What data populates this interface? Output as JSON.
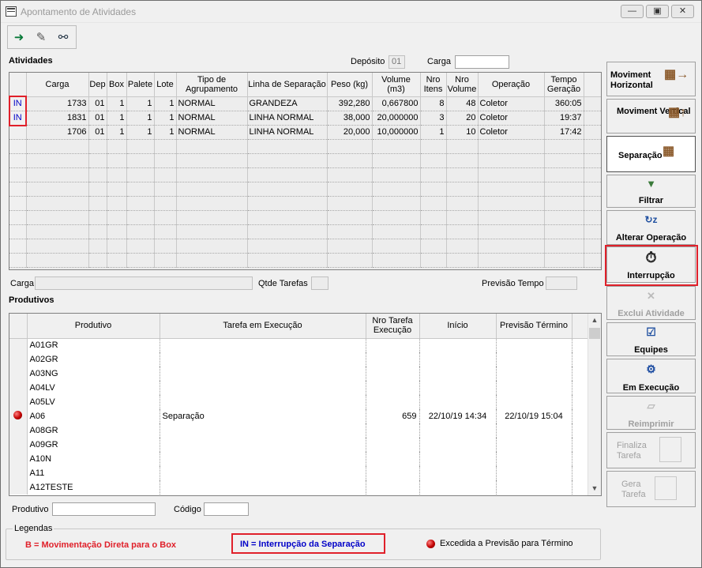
{
  "window": {
    "title": "Apontamento de Atividades"
  },
  "toolbar": {
    "buttons": [
      {
        "name": "exit-icon",
        "glyph": "⇥"
      },
      {
        "name": "eraser-icon",
        "glyph": "✎"
      },
      {
        "name": "binoculars-icon",
        "glyph": "⌕"
      }
    ]
  },
  "atividades": {
    "title": "Atividades",
    "deposito_label": "Depósito",
    "deposito_value": "01",
    "carga_label": "Carga",
    "carga_value": "",
    "columns": [
      "",
      "Carga",
      "Dep",
      "Box",
      "Palete",
      "Lote",
      "Tipo de Agrupamento",
      "Linha de Separação",
      "Peso (kg)",
      "Volume (m3)",
      "Nro Itens",
      "Nro Volume",
      "Operação",
      "Tempo Geração"
    ],
    "rows": [
      [
        "IN",
        "1733",
        "01",
        "1",
        "1",
        "1",
        "NORMAL",
        "GRANDEZA",
        "392,280",
        "0,667800",
        "8",
        "48",
        "Coletor",
        "360:05"
      ],
      [
        "IN",
        "1831",
        "01",
        "1",
        "1",
        "1",
        "NORMAL",
        "LINHA NORMAL",
        "38,000",
        "20,000000",
        "3",
        "20",
        "Coletor",
        "19:37"
      ],
      [
        "",
        "1706",
        "01",
        "1",
        "1",
        "1",
        "NORMAL",
        "LINHA NORMAL",
        "20,000",
        "10,000000",
        "1",
        "10",
        "Coletor",
        "17:42"
      ]
    ],
    "empty_rows": 9
  },
  "summary": {
    "carga_label": "Carga",
    "carga_value": "",
    "qtde_label": "Qtde Tarefas",
    "qtde_value": "",
    "previsao_label": "Previsão Tempo",
    "previsao_value": ""
  },
  "produtivos": {
    "title": "Produtivos",
    "columns": [
      "",
      "Produtivo",
      "Tarefa em Execução",
      "Nro Tarefa Execução",
      "Início",
      "Previsão Término"
    ],
    "rows": [
      [
        "",
        "A01GR",
        "",
        "",
        "",
        ""
      ],
      [
        "",
        "A02GR",
        "",
        "",
        "",
        ""
      ],
      [
        "",
        "A03NG",
        "",
        "",
        "",
        ""
      ],
      [
        "",
        "A04LV",
        "",
        "",
        "",
        ""
      ],
      [
        "",
        "A05LV",
        "",
        "",
        "",
        ""
      ],
      [
        "dot",
        "A06",
        "Separação",
        "659",
        "22/10/19 14:34",
        "22/10/19 15:04"
      ],
      [
        "",
        "A08GR",
        "",
        "",
        "",
        ""
      ],
      [
        "",
        "A09GR",
        "",
        "",
        "",
        ""
      ],
      [
        "",
        "A10N",
        "",
        "",
        "",
        ""
      ],
      [
        "",
        "A11",
        "",
        "",
        "",
        ""
      ],
      [
        "",
        "A12TESTE",
        "",
        "",
        "",
        ""
      ]
    ]
  },
  "filters": {
    "produtivo_label": "Produtivo",
    "produtivo_value": "",
    "codigo_label": "Código",
    "codigo_value": ""
  },
  "legend": {
    "title": "Legendas",
    "item1": "B = Movimentação Direta para o Box",
    "item2": "IN = Interrupção da Separação",
    "item3": "Excedida a Previsão para Término",
    "colors": {
      "red": "#e0202a",
      "blue": "#0000c8"
    }
  },
  "side_buttons": [
    {
      "name": "moviment-horizontal-button",
      "label": "Moviment Horizontal",
      "icon": "pallet-horizontal-icon",
      "enabled": true
    },
    {
      "name": "moviment-vertical-button",
      "label": "Moviment Vertical",
      "icon": "pallet-vertical-icon",
      "enabled": true
    },
    {
      "name": "separacao-button",
      "label": "Separação",
      "icon": "pallet-separation-icon",
      "enabled": true
    },
    {
      "name": "filtrar-button",
      "label": "Filtrar",
      "icon": "filter-icon",
      "enabled": true
    },
    {
      "name": "alterar-operacao-button",
      "label": "Alterar Operação",
      "icon": "sort-az-icon",
      "enabled": true
    },
    {
      "name": "interrupcao-button",
      "label": "Interrupção",
      "icon": "stopwatch-icon",
      "enabled": true
    },
    {
      "name": "exclui-atividade-button",
      "label": "Exclui Atividade",
      "icon": "delete-icon",
      "enabled": false
    },
    {
      "name": "equipes-button",
      "label": "Equipes",
      "icon": "checklist-icon",
      "enabled": true
    },
    {
      "name": "em-execucao-button",
      "label": "Em Execução",
      "icon": "user-gear-icon",
      "enabled": true
    },
    {
      "name": "reimprimir-button",
      "label": "Reimprimir",
      "icon": "printer-icon",
      "enabled": false
    },
    {
      "name": "finaliza-tarefa-button",
      "label": "Finaliza Tarefa",
      "icon": "finish-icon",
      "enabled": false
    },
    {
      "name": "gera-tarefa-button",
      "label": "Gera Tarefa",
      "icon": "generate-icon",
      "enabled": false
    }
  ]
}
